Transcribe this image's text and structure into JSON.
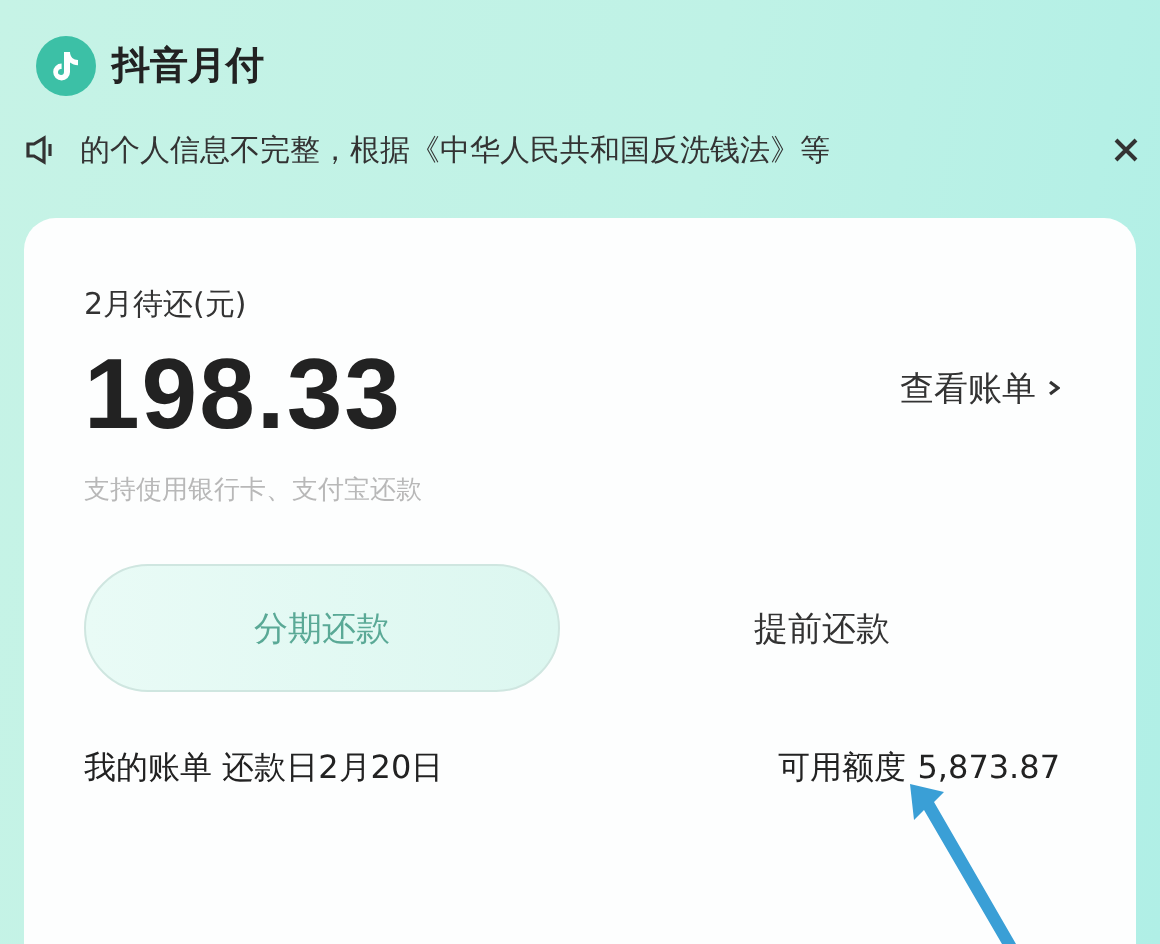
{
  "app": {
    "title": "抖音月付"
  },
  "notice": {
    "text": "的个人信息不完整，根据《中华人民共和国反洗钱法》等"
  },
  "bill": {
    "label": "2月待还(元)",
    "amount": "198.33",
    "view_link": "查看账单",
    "hint": "支持使用银行卡、支付宝还款",
    "buttons": [
      {
        "label": "分期还款",
        "kind": "primary"
      },
      {
        "label": "提前还款",
        "kind": "plain"
      }
    ],
    "footer_left": "我的账单 还款日2月20日",
    "credit_label": "可用额度",
    "credit_value": "5,873.87"
  }
}
